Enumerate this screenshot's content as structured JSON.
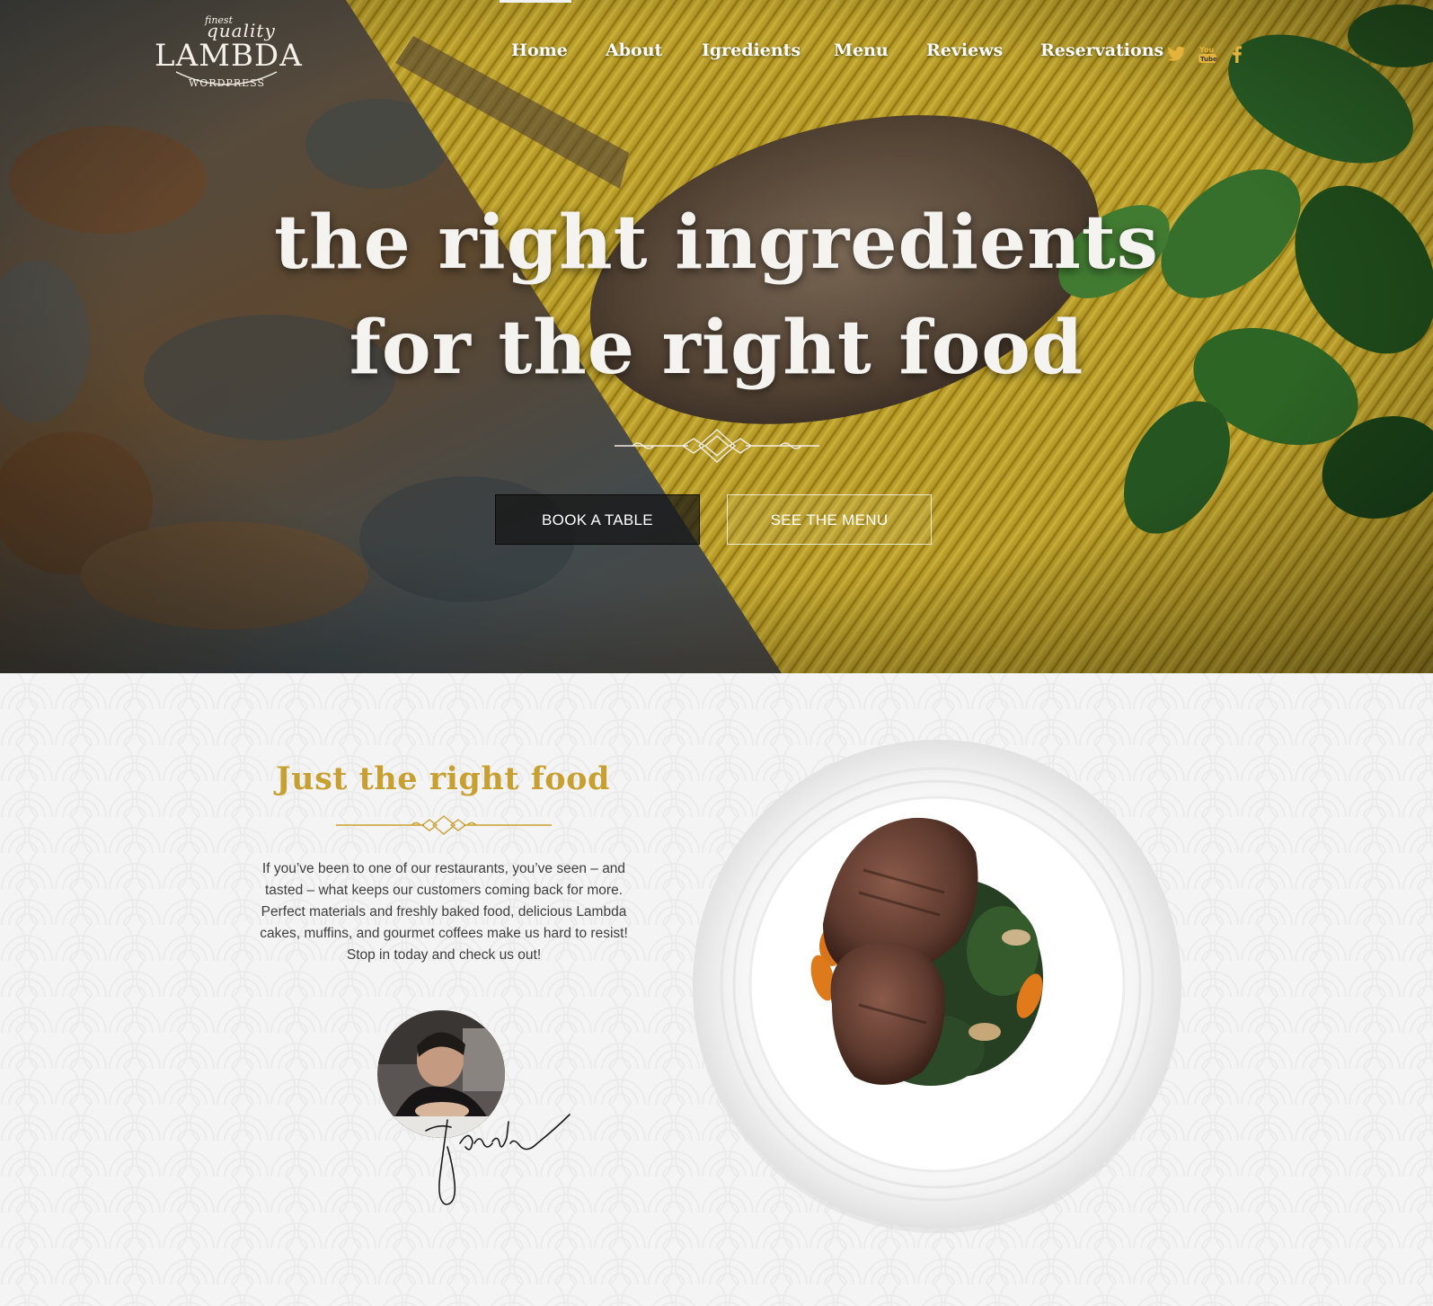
{
  "brand": {
    "finest": "finest",
    "quality": "quality",
    "name": "LAMBDA",
    "sub": "WORDPRESS"
  },
  "nav": {
    "items": [
      {
        "label": "Home",
        "active": true
      },
      {
        "label": "About"
      },
      {
        "label": "Igredients"
      },
      {
        "label": "Menu"
      },
      {
        "label": "Reviews"
      },
      {
        "label": "Reservations"
      }
    ],
    "social": [
      "twitter-icon",
      "youtube-icon",
      "facebook-icon"
    ],
    "social_color": "#e3b33b"
  },
  "hero": {
    "line1": "the right ingredients",
    "line2": "for the right food",
    "book_label": "BOOK A TABLE",
    "menu_label": "SEE THE MENU"
  },
  "about": {
    "title": "Just the right food",
    "text": "If you’ve been to one of our restaurants, you’ve seen – and tasted – what keeps our customers coming back for more. Perfect materials and freshly baked food, delicious Lambda cakes,  muffins, and gourmet coffees make us hard to resist! Stop in today and check us out!",
    "accent": "#c8a032"
  }
}
